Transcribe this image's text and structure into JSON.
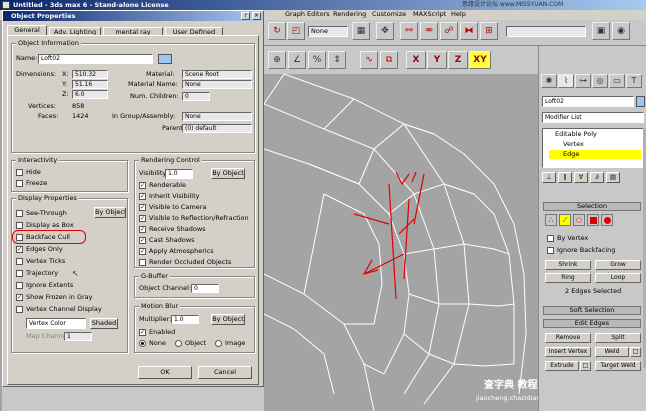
{
  "window": {
    "title": "Untitled - 3ds max 6 - Stand-alone License"
  },
  "watermark_top": "思缘设计论坛 www.MISSYUAN.COM",
  "watermark_bottom": {
    "line1": "查字典 教程网",
    "line2": "jiaocheng.chazidian.com"
  },
  "menubar": {
    "items": [
      "Graph Editors",
      "Rendering",
      "Customize",
      "MAXScript",
      "Help"
    ]
  },
  "toolbar": {
    "selection_filter": "None",
    "named_set": "",
    "axis_x": "X",
    "axis_y": "Y",
    "axis_z": "Z",
    "axis_xy": "XY"
  },
  "dialog": {
    "title": "Object Properties",
    "tabs": [
      "General",
      "Adv. Lighting",
      "mental ray",
      "User Defined"
    ],
    "object_info": {
      "title": "Object Information",
      "name_label": "Name:",
      "name_value": "Loft02",
      "dimensions_label": "Dimensions:",
      "x_label": "X:",
      "x_value": "510.32",
      "y_label": "Y:",
      "y_value": "51.16",
      "z_label": "Z:",
      "z_value": "6.0",
      "vertices_label": "Vertices:",
      "vertices_value": "858",
      "faces_label": "Faces:",
      "faces_value": "1424",
      "material_label": "Material:",
      "material_value": "Scene Root",
      "material_name_label": "Material Name:",
      "material_name_value": "None",
      "num_children_label": "Num. Children:",
      "num_children_value": "0",
      "group_label": "In Group/Assembly:",
      "group_value": "None",
      "parent_label": "Parent:",
      "parent_value": "(0) default"
    },
    "interactivity": {
      "title": "Interactivity",
      "hide": "Hide",
      "freeze": "Freeze"
    },
    "display_properties": {
      "title": "Display Properties",
      "see_through": "See-Through",
      "by_object": "By Object",
      "display_as_box": "Display as Box",
      "backface_cull": "Backface Cull",
      "edges_only": "Edges Only",
      "vertex_ticks": "Vertex Ticks",
      "trajectory": "Trajectory",
      "ignore_extents": "Ignore Extents",
      "show_frozen_gray": "Show Frozen in Gray",
      "vertex_channel_display": "Vertex Channel Display",
      "vertex_color": "Vertex Color",
      "shaded": "Shaded",
      "map_channel_label": "Map Channel:",
      "map_channel_value": "1"
    },
    "rendering_control": {
      "title": "Rendering Control",
      "visibility_label": "Visibility:",
      "visibility_value": "1.0",
      "by_object": "By Object",
      "renderable": "Renderable",
      "inherit_visibility": "Inherit Visibility",
      "visible_to_camera": "Visible to Camera",
      "visible_to_reflection": "Visible to Reflection/Refraction",
      "receive_shadows": "Receive Shadows",
      "cast_shadows": "Cast Shadows",
      "apply_atmospherics": "Apply Atmospherics",
      "render_occluded": "Render Occluded Objects"
    },
    "g_buffer": {
      "title": "G-Buffer",
      "object_channel_label": "Object Channel:",
      "object_channel_value": "0"
    },
    "motion_blur": {
      "title": "Motion Blur",
      "multiplier_label": "Multiplier:",
      "multiplier_value": "1.0",
      "by_object": "By Object",
      "enabled": "Enabled",
      "none": "None",
      "object": "Object",
      "image": "Image"
    },
    "ok": "OK",
    "cancel": "Cancel"
  },
  "command_panel": {
    "object_name": "Loft02",
    "modifier_list": "Modifier List",
    "stack": [
      "Editable Poly",
      "Vertex",
      "Edge"
    ],
    "selection_title": "Selection",
    "by_vertex": "By Vertex",
    "ignore_backfacing": "Ignore Backfacing",
    "shrink": "Shrink",
    "grow": "Grow",
    "ring": "Ring",
    "loop": "Loop",
    "selected_status": "2 Edges Selected",
    "soft_selection": "Soft Selection",
    "edit_edges": "Edit Edges",
    "remove": "Remove",
    "split": "Split",
    "insert_vertex": "Insert Vertex",
    "weld": "Weld",
    "extrude": "Extrude",
    "target_weld": "Target Weld"
  },
  "colors": {
    "annotation_red": "#e00000",
    "selection_yellow": "#ffff00",
    "wire": "#ffffff"
  }
}
